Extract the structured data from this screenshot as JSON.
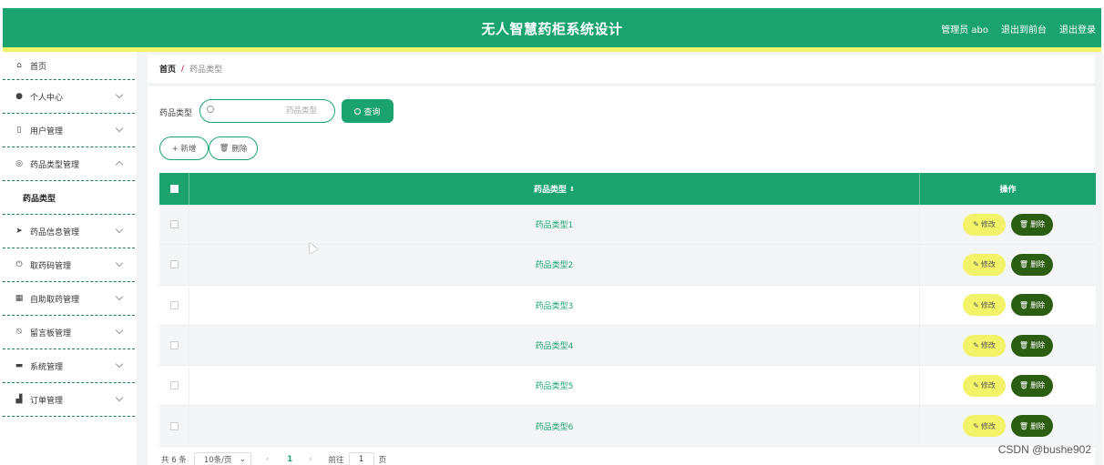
{
  "header": {
    "title": "无人智慧药柜系统设计",
    "admin_label": "管理员 abo",
    "back_to_front": "退出到前台",
    "logout": "退出登录"
  },
  "sidebar": {
    "items": [
      {
        "label": "首页",
        "icon": "home-icon"
      },
      {
        "label": "个人中心",
        "icon": "user-icon"
      },
      {
        "label": "用户管理",
        "icon": "phone-icon"
      },
      {
        "label": "药品类型管理",
        "icon": "compass-icon"
      },
      {
        "label": "药品信息管理",
        "icon": "send-icon"
      },
      {
        "label": "取药码管理",
        "icon": "power-icon"
      },
      {
        "label": "自助取药管理",
        "icon": "chart-icon"
      },
      {
        "label": "留言板管理",
        "icon": "bell-off-icon"
      },
      {
        "label": "系统管理",
        "icon": "message-icon"
      },
      {
        "label": "订单管理",
        "icon": "thumb-icon"
      }
    ],
    "sub_item": "药品类型"
  },
  "breadcrumb": {
    "home": "首页",
    "separator": "/",
    "current": "药品类型"
  },
  "search": {
    "label": "药品类型",
    "placeholder": "药品类型",
    "value": "",
    "query_label": "查询"
  },
  "actions": {
    "add_label": "+ 新增",
    "delete_label": "删除"
  },
  "table": {
    "columns": [
      "药品类型",
      "操作"
    ],
    "rows": [
      {
        "type": "药品类型1"
      },
      {
        "type": "药品类型2"
      },
      {
        "type": "药品类型3"
      },
      {
        "type": "药品类型4"
      },
      {
        "type": "药品类型5"
      },
      {
        "type": "药品类型6"
      }
    ],
    "edit_label": "修改",
    "delete_label": "删除"
  },
  "pagination": {
    "total": "共 6 条",
    "page_size": "10条/页",
    "current_page": "1",
    "goto_label": "前往",
    "goto_value": "1",
    "page_suffix": "页"
  },
  "watermark": "CSDN @bushe902",
  "colors": {
    "primary": "#1aa36f",
    "accent_yellow": "#f3f36a",
    "delete_dark": "#2b5e12"
  }
}
